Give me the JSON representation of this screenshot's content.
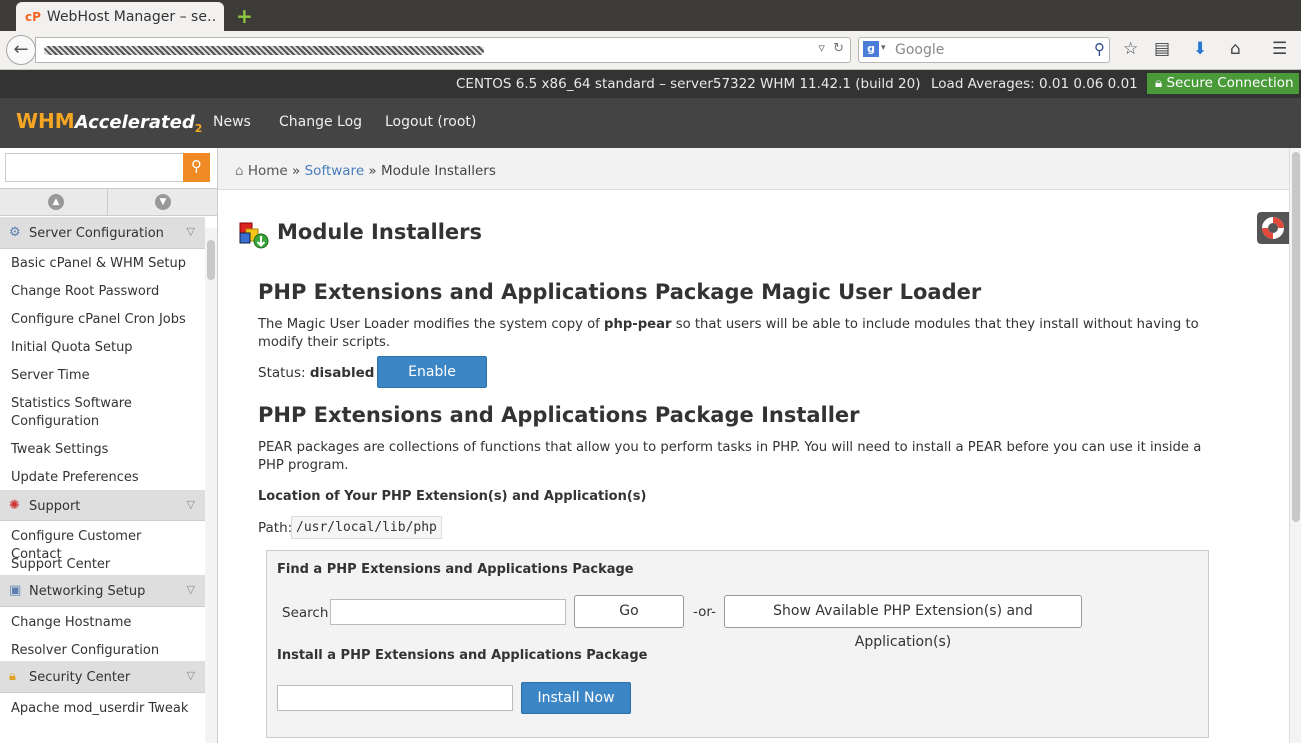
{
  "browser": {
    "tab_title": "WebHost Manager – se…",
    "tab_favicon": "cP",
    "search_placeholder": "Google",
    "search_engine_glyph": "g"
  },
  "status": {
    "os": "CENTOS 6.5 x86_64 standard – server57322",
    "version": "WHM 11.42.1 (build 20)",
    "load": "Load Averages: 0.01 0.06 0.01",
    "secure": "Secure Connection"
  },
  "header": {
    "logo_main": "WHM",
    "logo_sub": "Accelerated",
    "logo_num": "2",
    "nav": [
      "News",
      "Change Log",
      "Logout (root)"
    ]
  },
  "sidebar": {
    "sections": [
      {
        "title": "Server Configuration",
        "icon": "gear-icon",
        "items": [
          "Basic cPanel & WHM Setup",
          "Change Root Password",
          "Configure cPanel Cron Jobs",
          "Initial Quota Setup",
          "Server Time",
          "Statistics Software Configuration",
          "Tweak Settings",
          "Update Preferences"
        ]
      },
      {
        "title": "Support",
        "icon": "lifebuoy-icon",
        "items": [
          "Configure Customer Contact",
          "Support Center"
        ]
      },
      {
        "title": "Networking Setup",
        "icon": "network-icon",
        "items": [
          "Change Hostname",
          "Resolver Configuration"
        ]
      },
      {
        "title": "Security Center",
        "icon": "lock-icon",
        "items": [
          "Apache mod_userdir Tweak"
        ]
      }
    ]
  },
  "breadcrumb": {
    "home": "Home",
    "sep": "»",
    "software": "Software",
    "current": "Module Installers"
  },
  "main": {
    "title": "Module Installers",
    "loader_heading": "PHP Extensions and Applications Package Magic User Loader",
    "loader_desc_pre": "The Magic User Loader modifies the system copy of ",
    "loader_desc_bold": "php-pear",
    "loader_desc_post": " so that users will be able to include modules that they install without having to modify their scripts.",
    "status_label": "Status:",
    "status_value": "disabled",
    "enable_label": "Enable",
    "installer_heading": "PHP Extensions and Applications Package Installer",
    "installer_desc": "PEAR packages are collections of functions that allow you to perform tasks in PHP. You will need to install a PEAR before you can use it inside a PHP program.",
    "location_heading": "Location of Your PHP Extension(s) and Application(s)",
    "path_label": "Path:",
    "path_value": "/usr/local/lib/php",
    "find_heading": "Find a PHP Extensions and Applications Package",
    "search_label": "Search",
    "search_value": "",
    "go_label": "Go",
    "or_label": "-or-",
    "show_label": "Show Available PHP Extension(s) and Application(s)",
    "install_heading": "Install a PHP Extensions and Applications Package",
    "install_value": "",
    "install_label": "Install Now"
  },
  "colors": {
    "accent_blue": "#3d86c6",
    "secure_green": "#4a9a3a",
    "orange": "#f08a24"
  }
}
